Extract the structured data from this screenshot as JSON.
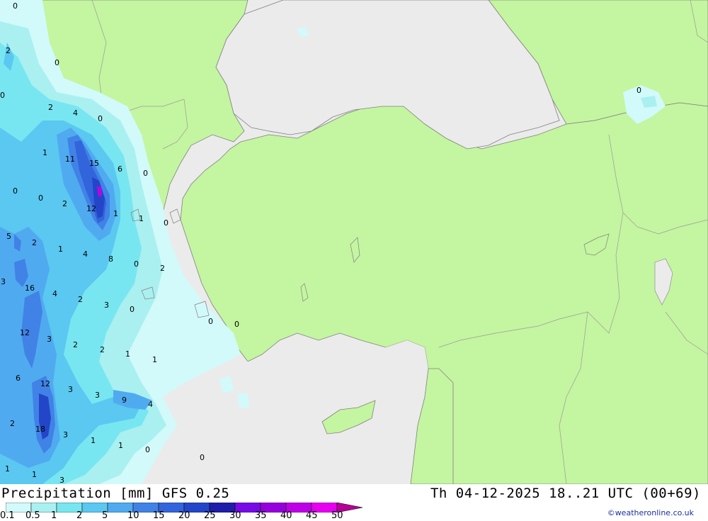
{
  "title": "Precipitation [mm] GFS 0.25",
  "datetime": "Th 04-12-2025 18..21 UTC (00+69)",
  "credit": "©weatheronline.co.uk",
  "legend": {
    "labels": [
      "0.1",
      "0.5",
      "1",
      "2",
      "5",
      "10",
      "15",
      "20",
      "25",
      "30",
      "35",
      "40",
      "45",
      "50"
    ],
    "colors": [
      "#d2fafa",
      "#aaf0f0",
      "#78e6f0",
      "#5ac8f0",
      "#50aaf0",
      "#4182e6",
      "#3264dc",
      "#2346c8",
      "#1e1eaa",
      "#780ae6",
      "#9600dc",
      "#be00e6",
      "#e600f0",
      "#b40096"
    ]
  },
  "colors": {
    "sea": "#ebebeb",
    "land": "#c4f5a0",
    "border": "#9a9a9a",
    "coast": "#808080"
  },
  "contour_labels": [
    "0",
    "2",
    "0",
    "0",
    "2",
    "4",
    "0",
    "1",
    "11",
    "15",
    "6",
    "0",
    "0",
    "0",
    "2",
    "12",
    "1",
    "1",
    "0",
    "5",
    "2",
    "1",
    "4",
    "8",
    "0",
    "2",
    "3",
    "16",
    "4",
    "2",
    "3",
    "0",
    "12",
    "3",
    "2",
    "2",
    "1",
    "0",
    "0",
    "1",
    "6",
    "12",
    "3",
    "3",
    "9",
    "4",
    "2",
    "18",
    "3",
    "1",
    "1",
    "0",
    "0",
    "1",
    "1",
    "3"
  ]
}
